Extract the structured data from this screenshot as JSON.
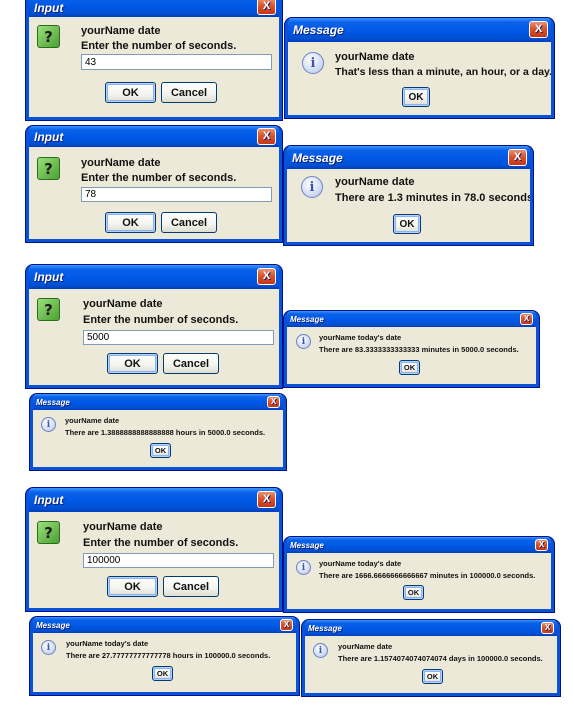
{
  "input_dialogs": [
    {
      "title": "Input",
      "line1": "yourName  date",
      "prompt": "Enter the number of seconds.",
      "value": "43",
      "ok": "OK",
      "cancel": "Cancel",
      "close": "X",
      "icon": "question-icon"
    },
    {
      "title": "Input",
      "line1": "yourName  date",
      "prompt": "Enter the number of seconds.",
      "value": "78",
      "ok": "OK",
      "cancel": "Cancel",
      "close": "X",
      "icon": "question-icon"
    },
    {
      "title": "Input",
      "line1": "yourName  date",
      "prompt": "Enter the number of seconds.",
      "value": "5000",
      "ok": "OK",
      "cancel": "Cancel",
      "close": "X",
      "icon": "question-icon"
    },
    {
      "title": "Input",
      "line1": "yourName  date",
      "prompt": "Enter the number of seconds.",
      "value": "100000",
      "ok": "OK",
      "cancel": "Cancel",
      "close": "X",
      "icon": "question-icon"
    }
  ],
  "message_dialogs": [
    {
      "title": "Message",
      "line1": "yourName  date",
      "line2": "That's less than a minute, an hour, or a day.",
      "ok": "OK",
      "close": "X",
      "icon": "info-icon"
    },
    {
      "title": "Message",
      "line1": "yourName  date",
      "line2": "There are 1.3 minutes in 78.0 seconds.",
      "ok": "OK",
      "close": "X",
      "icon": "info-icon"
    },
    {
      "title": "Message",
      "line1": "yourName  today's date",
      "line2": "There are 83.3333333333333 minutes in 5000.0 seconds.",
      "ok": "OK",
      "close": "X",
      "icon": "info-icon"
    },
    {
      "title": "Message",
      "line1": "yourName  date",
      "line2": "There are 1.3888888888888888 hours in 5000.0 seconds.",
      "ok": "OK",
      "close": "X",
      "icon": "info-icon"
    },
    {
      "title": "Message",
      "line1": "yourName  today's date",
      "line2": "There are 1666.6666666666667 minutes in 100000.0 seconds.",
      "ok": "OK",
      "close": "X",
      "icon": "info-icon"
    },
    {
      "title": "Message",
      "line1": "yourName  today's date",
      "line2": "There are 27.77777777777778 hours in 100000.0 seconds.",
      "ok": "OK",
      "close": "X",
      "icon": "info-icon"
    },
    {
      "title": "Message",
      "line1": "yourName  date",
      "line2": "There are 1.1574074074074074 days in 100000.0 seconds.",
      "ok": "OK",
      "close": "X",
      "icon": "info-icon"
    }
  ],
  "glyphs": {
    "question": "?",
    "info": "i"
  }
}
